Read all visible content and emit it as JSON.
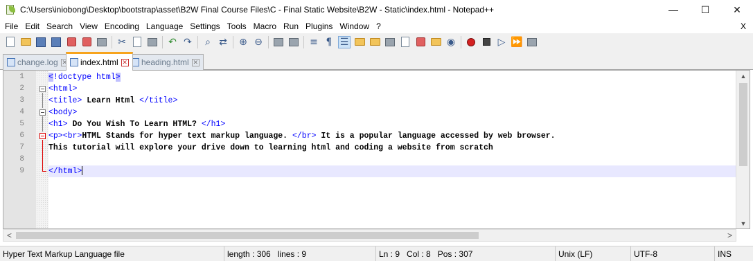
{
  "window": {
    "title": "C:\\Users\\iniobong\\Desktop\\bootstrap\\asset\\B2W Final Course Files\\C - Final Static Website\\B2W - Static\\index.html - Notepad++",
    "minimize": "—",
    "maximize": "☐",
    "close": "✕"
  },
  "menu": {
    "items": [
      "File",
      "Edit",
      "Search",
      "View",
      "Encoding",
      "Language",
      "Settings",
      "Tools",
      "Macro",
      "Run",
      "Plugins",
      "Window",
      "?"
    ],
    "close_doc": "X"
  },
  "tabs": [
    {
      "label": "change.log",
      "active": false
    },
    {
      "label": "index.html",
      "active": true
    },
    {
      "label": "heading.html",
      "active": false
    }
  ],
  "editor": {
    "line_numbers": [
      "1",
      "2",
      "3",
      "4",
      "5",
      "6",
      "7",
      "8",
      "9"
    ],
    "lines": [
      [
        "<",
        "!",
        "doctype html",
        ">"
      ],
      [
        "<html>"
      ],
      [
        "<title>",
        " Learn Html ",
        "</title>"
      ],
      [
        "<body>"
      ],
      [
        "<h1>",
        " Do You Wish To Learn HTML? ",
        "</h1>"
      ],
      [
        "<p>",
        "<br>",
        "HTML Stands for hyper text markup language. ",
        "</br>",
        " It is a popular language accessed by web browser."
      ],
      [
        "This tutorial will explore your drive down to learning html and coding a website from scratch"
      ],
      [
        ""
      ],
      [
        "</html>"
      ]
    ],
    "current_line": 9
  },
  "scrollbars": {
    "up": "▲",
    "down": "▼",
    "left": "<",
    "right": ">"
  },
  "status": {
    "file_type": "Hyper Text Markup Language file",
    "length": "length : 306",
    "lines": "lines : 9",
    "ln": "Ln : 9",
    "col": "Col : 8",
    "pos": "Pos : 307",
    "eol": "Unix (LF)",
    "encoding": "UTF-8",
    "mode": "INS"
  }
}
